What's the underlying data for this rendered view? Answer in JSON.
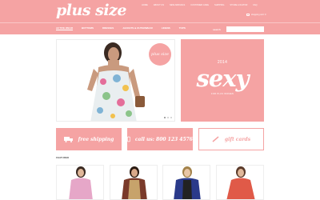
{
  "brand": {
    "logo": "plus size"
  },
  "top_links": [
    "home",
    "about us",
    "new arrivals",
    "customer care",
    "shipping",
    "store locator",
    "faq"
  ],
  "cart": {
    "label": "shopping cart: 0"
  },
  "nav": {
    "items": [
      "active wear",
      "bottoms",
      "dresses",
      "jackets & outerwear",
      "linens",
      "tops"
    ],
    "search_label": "search",
    "search_placeholder": ""
  },
  "slider": {
    "badge": "plus size"
  },
  "promo": {
    "year": "2014",
    "word": "sexy",
    "subtitle": "for plus women"
  },
  "features": {
    "shipping": "free shipping",
    "call": "call us: 800 123 4576",
    "gift": "gift cards"
  },
  "featured": {
    "title": "featured"
  },
  "colors": {
    "accent": "#f5a3a3",
    "white": "#ffffff"
  },
  "icons": {
    "cart": "cart-icon",
    "truck": "truck-icon",
    "phone": "phone-icon",
    "pen": "pen-icon"
  }
}
